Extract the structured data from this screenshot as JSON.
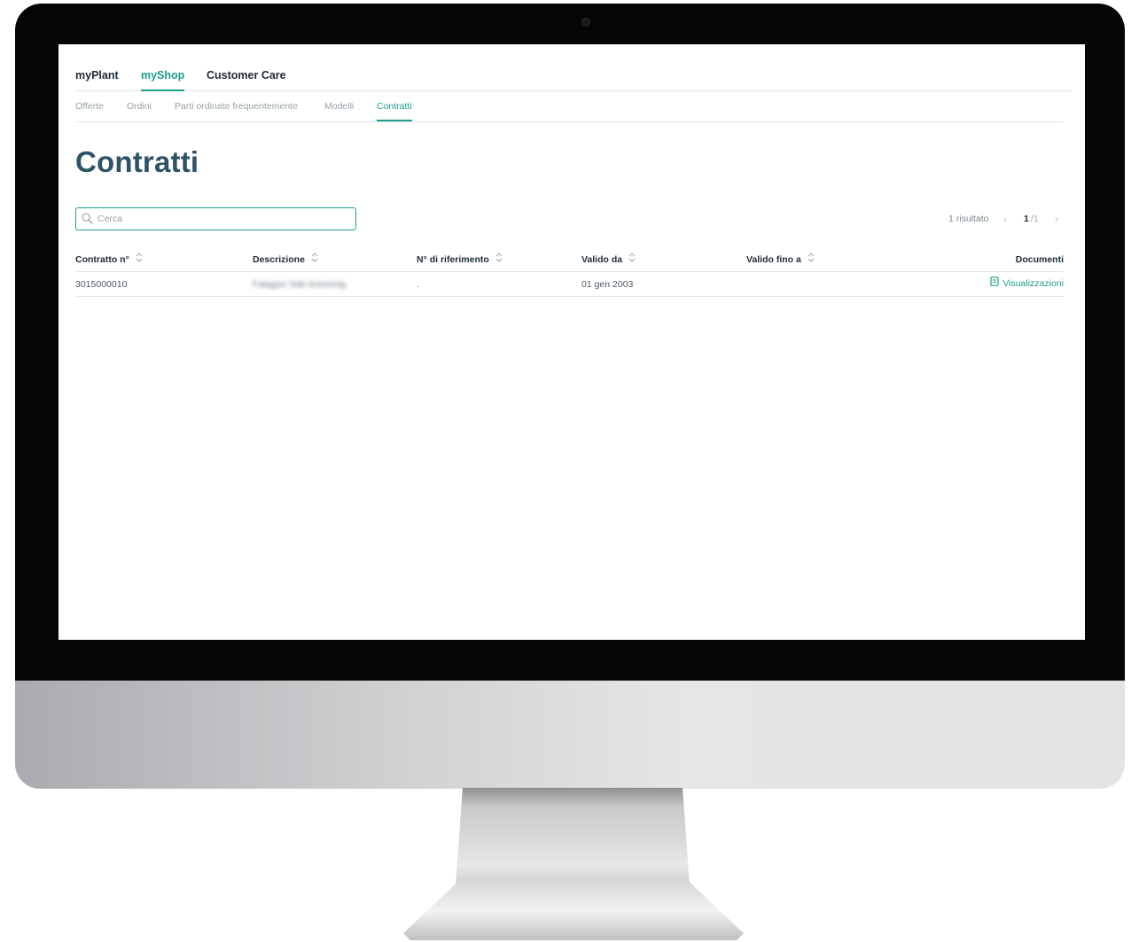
{
  "primary_nav": [
    {
      "label": "myPlant",
      "active": false
    },
    {
      "label": "myShop",
      "active": true
    },
    {
      "label": "Customer Care",
      "active": false
    }
  ],
  "secondary_nav": [
    {
      "label": "Offerte",
      "active": false
    },
    {
      "label": "Ordini",
      "active": false
    },
    {
      "label": "Parti ordinate frequentemente",
      "active": false
    },
    {
      "label": "Modelli",
      "active": false
    },
    {
      "label": "Contratti",
      "active": true
    }
  ],
  "page_title": "Contratti",
  "search": {
    "placeholder": "Cerca",
    "value": ""
  },
  "pagination": {
    "results_label": "1 risultato",
    "current_page": "1",
    "total_pages": "/1"
  },
  "table": {
    "columns": [
      "Contratto n°",
      "Descrizione",
      "N° di riferimento",
      "Valido da",
      "Valido fino a",
      "Documenti"
    ],
    "rows": [
      {
        "contract_no": "3015000010",
        "description": "Fatagon Sde lesonmig",
        "reference_no": ".",
        "valid_from": "01 gen 2003",
        "valid_until": "",
        "documents_link": "Visualizzazioni"
      }
    ]
  },
  "colors": {
    "accent": "#1e9e8c",
    "title": "#2e5266",
    "text": "#1c2b36",
    "muted": "#98a2a8"
  }
}
